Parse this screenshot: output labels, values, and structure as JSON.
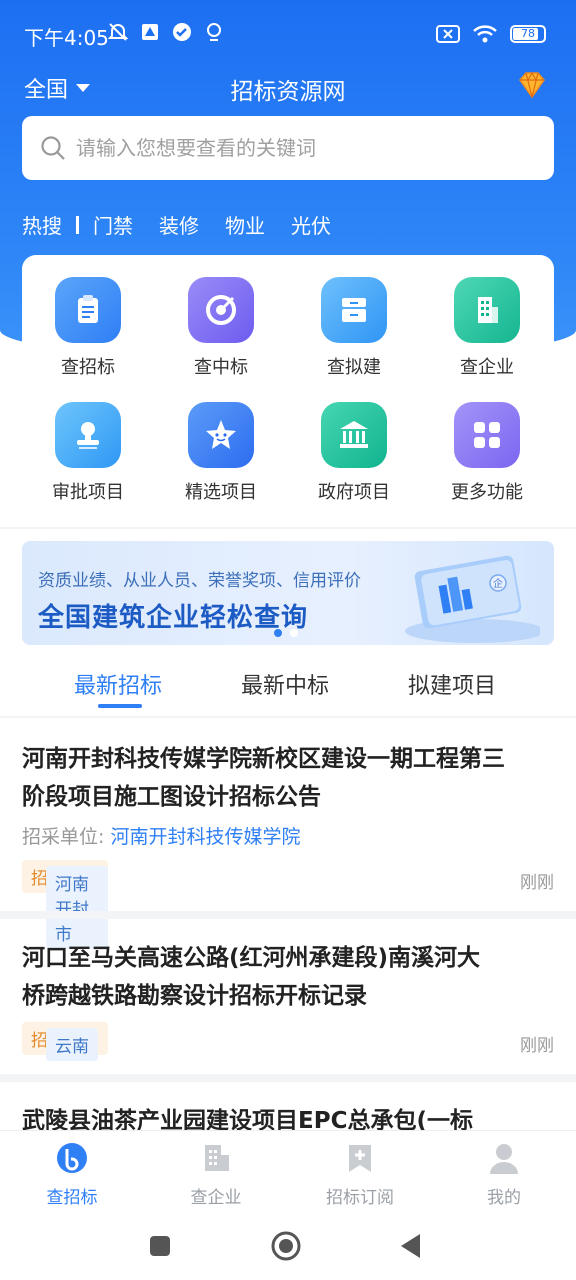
{
  "status": {
    "time": "下午4:05",
    "battery": "78"
  },
  "header": {
    "region": "全国",
    "title": "招标资源网"
  },
  "search": {
    "placeholder": "请输入您想要查看的关键词"
  },
  "hot": {
    "label": "热搜",
    "keywords": [
      "门禁",
      "装修",
      "物业",
      "光伏"
    ]
  },
  "grid": {
    "items": [
      {
        "label": "查招标",
        "icon": "clipboard-icon",
        "color": "#3b8cf6"
      },
      {
        "label": "查中标",
        "icon": "target-icon",
        "color": "#7a6af2"
      },
      {
        "label": "查拟建",
        "icon": "archive-icon",
        "color": "#3da3f7"
      },
      {
        "label": "查企业",
        "icon": "building-icon",
        "color": "#22c3a0"
      },
      {
        "label": "审批项目",
        "icon": "stamp-icon",
        "color": "#36a8f6"
      },
      {
        "label": "精选项目",
        "icon": "star-icon",
        "color": "#3b7ef3"
      },
      {
        "label": "政府项目",
        "icon": "government-icon",
        "color": "#1fbd9c"
      },
      {
        "label": "更多功能",
        "icon": "grid-icon",
        "color": "#8f7cf3"
      }
    ]
  },
  "banner": {
    "sub": "资质业绩、从业人员、荣誉奖项、信用评价",
    "main": "全国建筑企业轻松查询",
    "card_text": "企"
  },
  "tabs": [
    "最新招标",
    "最新中标",
    "拟建项目"
  ],
  "list": [
    {
      "title_line1": "河南开封科技传媒学院新校区建设一期工程第三",
      "title_line2": "阶段项目施工图设计招标公告",
      "buyer_label": "招采单位:",
      "buyer": "河南开封科技传媒学院",
      "region": "河南 开封市",
      "type": "招标公告",
      "time": "刚刚"
    },
    {
      "title_line1": "河口至马关高速公路(红河州承建段)南溪河大",
      "title_line2": "桥跨越铁路勘察设计招标开标记录",
      "region": "云南",
      "type": "招标公告",
      "time": "刚刚"
    },
    {
      "title_line1": "武陵县油茶产业园建设项目EPC总承包(一标"
    }
  ],
  "bottom_nav": [
    {
      "label": "查招标",
      "icon": "bid-search-icon"
    },
    {
      "label": "查企业",
      "icon": "company-icon"
    },
    {
      "label": "招标订阅",
      "icon": "subscribe-icon"
    },
    {
      "label": "我的",
      "icon": "profile-icon"
    }
  ],
  "colors": {
    "primary": "#1d6ff2",
    "accent": "#2f7ff5",
    "tag_orange": "#e28a2c"
  }
}
